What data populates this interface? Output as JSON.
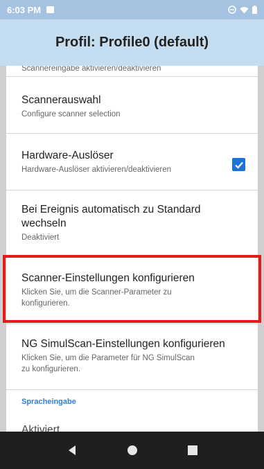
{
  "status_bar": {
    "time": "6:03 PM"
  },
  "app_bar": {
    "title": "Profil: Profile0 (default)"
  },
  "list": {
    "partial_top": "Scannereingabe aktivieren/deaktivieren",
    "items": [
      {
        "title": "Scannerauswahl",
        "subtitle": "Configure scanner selection"
      },
      {
        "title": "Hardware-Auslöser",
        "subtitle": "Hardware-Auslöser aktivieren/deaktivieren",
        "checked": true
      },
      {
        "title_line1": "Bei Ereignis automatisch zu Standard",
        "title_line2": "wechseln",
        "subtitle": "Deaktiviert"
      },
      {
        "title": "Scanner-Einstellungen konfigurieren",
        "subtitle_line1": "Klicken Sie, um die Scanner-Parameter zu",
        "subtitle_line2": "konfigurieren."
      },
      {
        "title": "NG SimulScan-Einstellungen konfigurieren",
        "subtitle_line1": "Klicken Sie, um die Parameter für NG SimulScan",
        "subtitle_line2": "zu konfigurieren."
      }
    ],
    "section_header": "Spracheingabe",
    "partial_bottom": "Aktiviert"
  },
  "colors": {
    "accent": "#1a73d9",
    "highlight": "#e51b1b",
    "appbar": "#c5ddf1",
    "statusbar": "#a5c3e0"
  }
}
